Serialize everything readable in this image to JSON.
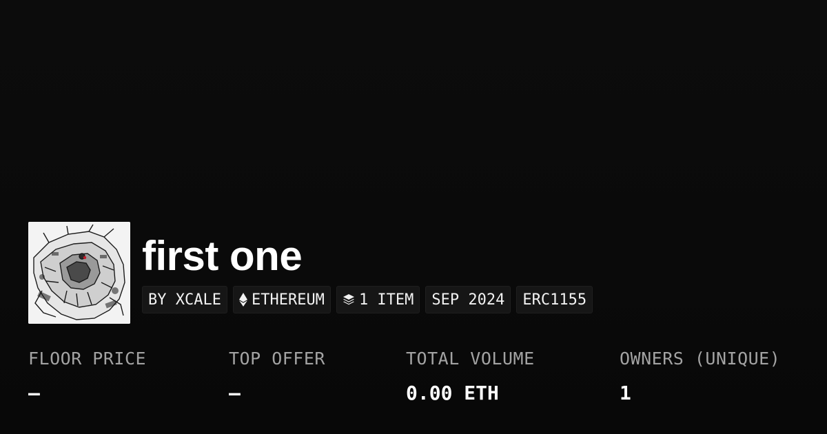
{
  "collection": {
    "name": "first one",
    "avatar_icon": "mecha-robot-artwork"
  },
  "chips": {
    "creator": "BY XCALE",
    "chain": "ETHEREUM",
    "chain_icon": "ethereum-icon",
    "items": "1 ITEM",
    "items_icon": "layers-icon",
    "date": "SEP 2024",
    "standard": "ERC1155"
  },
  "stats": {
    "floor_price": {
      "label": "FLOOR PRICE",
      "value": "–"
    },
    "top_offer": {
      "label": "TOP OFFER",
      "value": "–"
    },
    "total_volume": {
      "label": "TOTAL VOLUME",
      "value": "0.00 ETH"
    },
    "owners": {
      "label": "OWNERS (UNIQUE)",
      "value": "1"
    }
  },
  "colors": {
    "background": "#0a0a0a",
    "chip_background": "#161616",
    "label_gray": "#a3a3a3",
    "text": "#ffffff"
  }
}
